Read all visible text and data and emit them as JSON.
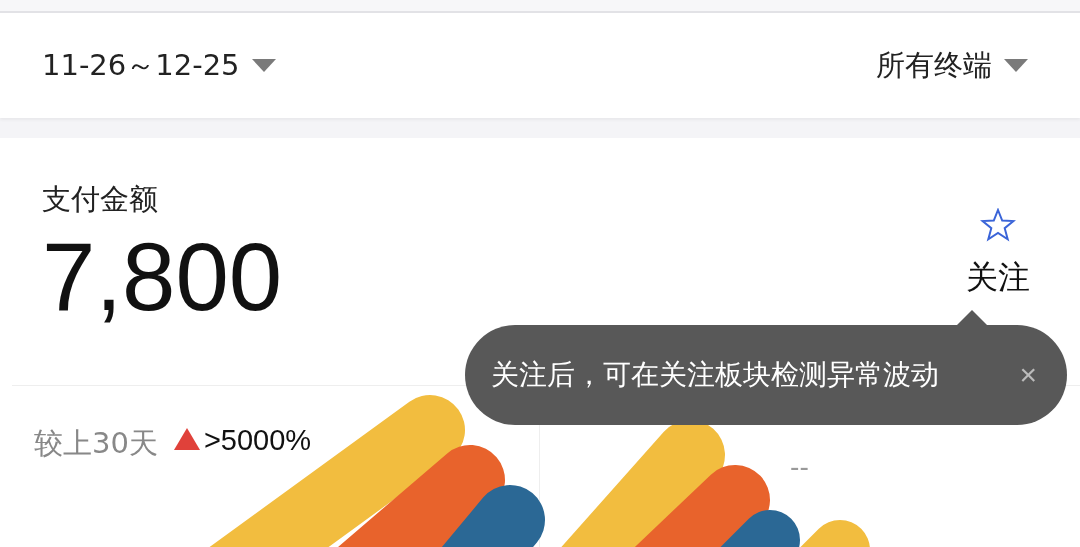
{
  "filter_bar": {
    "date_range": "11-26～12-25",
    "terminal": "所有终端"
  },
  "metric_card": {
    "title": "支付金额",
    "value": "7,800",
    "follow_label": "关注",
    "followed": false,
    "tooltip": {
      "text": "关注后，可在关注板块检测异常波动",
      "close": "×"
    },
    "comparisons": [
      {
        "label": "较上30天",
        "increase": true,
        "change": ">5000%"
      },
      {
        "change": "--"
      }
    ]
  }
}
